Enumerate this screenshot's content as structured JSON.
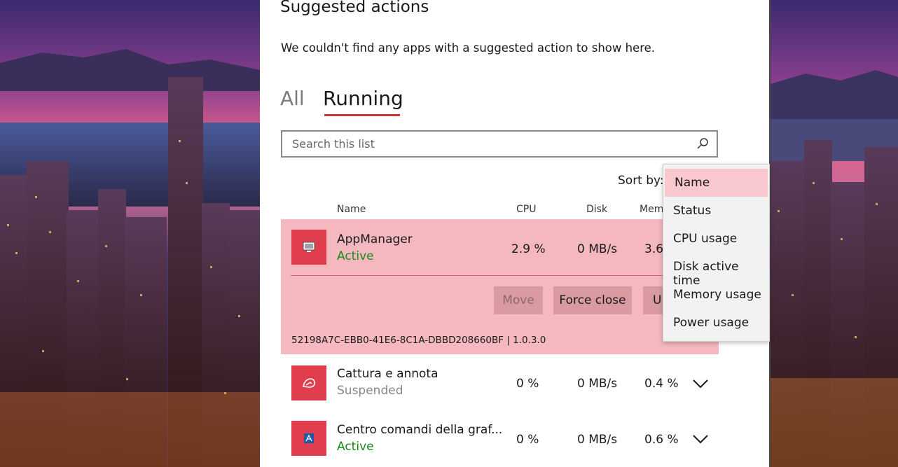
{
  "header": {
    "title": "Suggested actions",
    "empty_message": "We couldn't find any apps with a suggested action to show here."
  },
  "tabs": [
    {
      "label": "All",
      "selected": false
    },
    {
      "label": "Running",
      "selected": true
    }
  ],
  "search": {
    "placeholder": "Search this list",
    "icon": "search-icon"
  },
  "sort": {
    "label": "Sort by:"
  },
  "columns": [
    "Name",
    "CPU",
    "Disk",
    "Mem"
  ],
  "apps": [
    {
      "name": "AppManager",
      "status": "Active",
      "cpu": "2.9 %",
      "disk": "0 MB/s",
      "memory": "3.6",
      "expanded": true,
      "actions": [
        "Move",
        "Force close",
        "Ur"
      ],
      "id_version": "52198A7C-EBB0-41E6-8C1A-DBBD208660BF | 1.0.3.0"
    },
    {
      "name": "Cattura e annota",
      "status": "Suspended",
      "cpu": "0 %",
      "disk": "0 MB/s",
      "memory": "0.4 %",
      "expanded": false
    },
    {
      "name": "Centro comandi della graf...",
      "status": "Active",
      "cpu": "0 %",
      "disk": "0 MB/s",
      "memory": "0.6 %",
      "expanded": false
    }
  ],
  "sort_menu": {
    "items": [
      "Name",
      "Status",
      "CPU usage",
      "Disk active time",
      "Memory usage",
      "Power usage"
    ],
    "selected": "Name"
  },
  "colors": {
    "accent": "#d13438",
    "selected_row": "#f4b8be",
    "app_icon": "#e03e4c",
    "active_status": "#1a8a1a"
  }
}
